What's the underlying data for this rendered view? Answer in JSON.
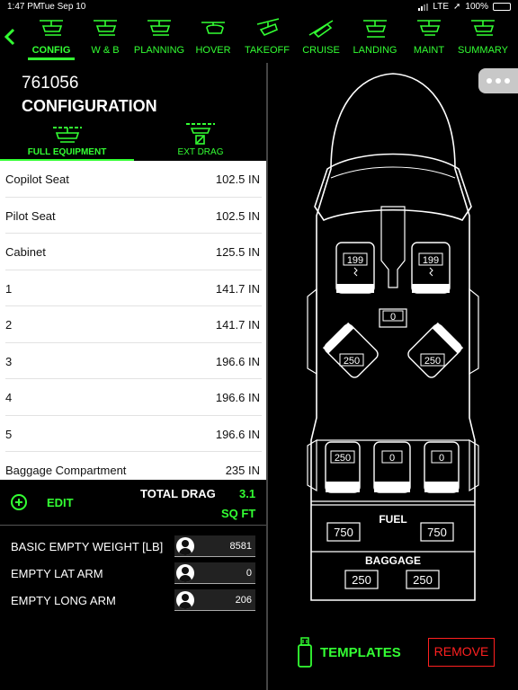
{
  "status_bar": {
    "time": "1:47 PM",
    "date": "Tue Sep 10",
    "network": "LTE",
    "battery": "100%",
    "battery_level": 1.0
  },
  "nav": {
    "back_icon": "chevron-left-icon",
    "tabs": [
      {
        "label": "CONFIG",
        "icon": "helicopter-config-icon",
        "active": true
      },
      {
        "label": "W & B",
        "icon": "helicopter-weight-balance-icon",
        "active": false
      },
      {
        "label": "PLANNING",
        "icon": "helicopter-planning-icon",
        "active": false
      },
      {
        "label": "HOVER",
        "icon": "helicopter-hover-icon",
        "active": false
      },
      {
        "label": "TAKEOFF",
        "icon": "helicopter-takeoff-icon",
        "active": false
      },
      {
        "label": "CRUISE",
        "icon": "helicopter-cruise-icon",
        "active": false
      },
      {
        "label": "LANDING",
        "icon": "helicopter-landing-icon",
        "active": false
      },
      {
        "label": "MAINT",
        "icon": "helicopter-maint-icon",
        "active": false
      },
      {
        "label": "SUMMARY",
        "icon": "helicopter-summary-icon",
        "active": false
      }
    ]
  },
  "config": {
    "tail_number": "761056",
    "title": "CONFIGURATION",
    "sub_tabs": [
      {
        "label": "FULL EQUIPMENT",
        "active": true
      },
      {
        "label": "EXT DRAG",
        "active": false
      }
    ],
    "equipment": [
      {
        "name": "Copilot Seat",
        "value": "102.5 IN"
      },
      {
        "name": "Pilot Seat",
        "value": "102.5 IN"
      },
      {
        "name": "Cabinet",
        "value": "125.5 IN"
      },
      {
        "name": "1",
        "value": "141.7 IN"
      },
      {
        "name": "2",
        "value": "141.7 IN"
      },
      {
        "name": "3",
        "value": "196.6 IN"
      },
      {
        "name": "4",
        "value": "196.6 IN"
      },
      {
        "name": "5",
        "value": "196.6 IN"
      },
      {
        "name": "Baggage Compartment",
        "value": "235 IN"
      }
    ],
    "edit_label": "EDIT",
    "total_drag_label": "TOTAL DRAG",
    "total_drag_value": "3.1",
    "total_drag_unit": "SQ FT",
    "weights": [
      {
        "label": "BASIC EMPTY WEIGHT [LB]",
        "value": "8581"
      },
      {
        "label": "EMPTY LAT ARM",
        "value": "0"
      },
      {
        "label": "EMPTY LONG ARM",
        "value": "206"
      }
    ]
  },
  "aircraft": {
    "seats": {
      "copilot": "199",
      "pilot": "199",
      "cabinet": "0",
      "seat_1": "250",
      "seat_2": "250",
      "seat_3": "250",
      "seat_4": "0",
      "seat_5": "0"
    },
    "fuel_label": "FUEL",
    "fuel_left": "750",
    "fuel_right": "750",
    "baggage_label": "BAGGAGE",
    "baggage_left": "250",
    "baggage_right": "250"
  },
  "actions": {
    "templates_label": "TEMPLATES",
    "remove_label": "REMOVE"
  },
  "colors": {
    "accent": "#33ff33",
    "danger": "#ff2020",
    "background": "#000000",
    "list_background": "#ffffff"
  }
}
